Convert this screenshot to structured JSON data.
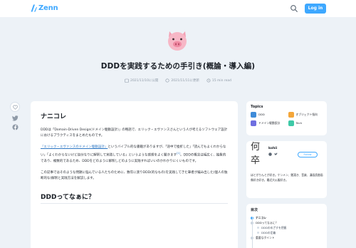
{
  "header": {
    "logo_text": "Zenn",
    "login_label": "Log in",
    "brand_color": "#3ea8ff"
  },
  "article": {
    "emoji": "pig-face",
    "title": "DDDを実践するための手引き(概論・導入編)",
    "published": "2021/11/10に公開",
    "updated": "2021/11/11に更新",
    "read_time": "15 min read",
    "likes": "",
    "section1_heading": "ナニコレ",
    "para1": "DDDは「Domain-Driven Design(ドメイン駆動設計)」の略語で、エリック・エヴァンスさんという人が考えるソフトウェア設計におけるプラクティスをまとめたものです。",
    "para2_link": "『エリック・エヴァンスのドメイン駆動設計』",
    "para2_rest": "というバイブル的な書籍がありますが、「途中で挫折した」「読んでもよくわからない」「よくわからないけど自分なりに解釈して実践している」というような感想をよく聞きます",
    "para2_footnote": "[1]",
    "para2_tail": "。DDDの概念は幅広く、抽象的であり、複数的であるため、DDDをどのように解釈しどのように実践すればいいのかわかりにくいものです。",
    "para3": "この記事ではそのような問題に悩んでいる人たちのために、数年に渡りDDD(的なもの)を実践してきた筆者が編み出した(個人の独断的な)解釈と実践方法を解説します。",
    "section2_heading": "DDDってなぁに？"
  },
  "topics": {
    "title": "Topics",
    "items": [
      {
        "label": "DDD",
        "color": "#3f8cd9"
      },
      {
        "label": "オブジェクト指向",
        "color": "#f4a63a"
      },
      {
        "label": "ドメイン駆動設計",
        "color": "#6f6fe0"
      },
      {
        "label": "Tech",
        "color": "#3ec9a7"
      }
    ]
  },
  "author": {
    "avatar_char": "何卒",
    "name": "kohii",
    "follow_label": "Follow",
    "bio": "ほとがりんとが好き。ケンメン、銭湯き、音楽、漫画読書画像好き好き。最近大仏服好き。"
  },
  "toc": {
    "title": "目次",
    "items": [
      {
        "label": "ナニコレ",
        "level": 1,
        "active": true
      },
      {
        "label": "DDDってなぁに？",
        "level": 1,
        "active": false
      },
      {
        "label": "DDDのめざすを把握",
        "level": 2,
        "active": false
      },
      {
        "label": "DDDの定義",
        "level": 2,
        "active": false
      },
      {
        "label": "重要なポイント",
        "level": 1,
        "active": false
      }
    ]
  }
}
